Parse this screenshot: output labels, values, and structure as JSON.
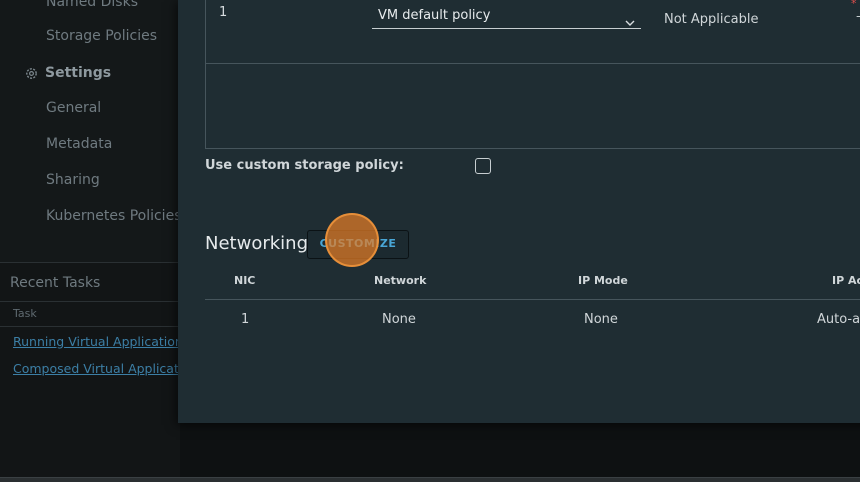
{
  "sidebar": {
    "items": [
      {
        "label": "Named Disks"
      },
      {
        "label": "Storage Policies"
      }
    ],
    "section": {
      "label": "Settings",
      "icon": "gear-icon"
    },
    "sub_items": [
      {
        "label": "General"
      },
      {
        "label": "Metadata"
      },
      {
        "label": "Sharing"
      },
      {
        "label": "Kubernetes Policies"
      }
    ]
  },
  "recent_tasks": {
    "title": "Recent Tasks",
    "column": "Task",
    "rows": [
      {
        "label": "Running Virtual Application"
      },
      {
        "label": "Composed Virtual Application"
      }
    ]
  },
  "storage": {
    "disk_id": "1",
    "policy_value": "VM default policy",
    "iops": "Not Applicable",
    "required_mark": "*",
    "dash": "–",
    "custom_policy_label": "Use custom storage policy:",
    "custom_policy_checked": false
  },
  "networking": {
    "title": "Networking",
    "customize_label": "CUSTOMIZE",
    "columns": [
      "NIC",
      "Network",
      "IP Mode",
      "IP Ac"
    ],
    "rows": [
      {
        "nic": "1",
        "network": "None",
        "ip_mode": "None",
        "ip_address": "Auto-a"
      }
    ]
  },
  "colors": {
    "modal_bg": "#1f2d33",
    "link": "#3c7fa6",
    "accent": "#49a6d6",
    "click_marker": "#e57d25"
  }
}
